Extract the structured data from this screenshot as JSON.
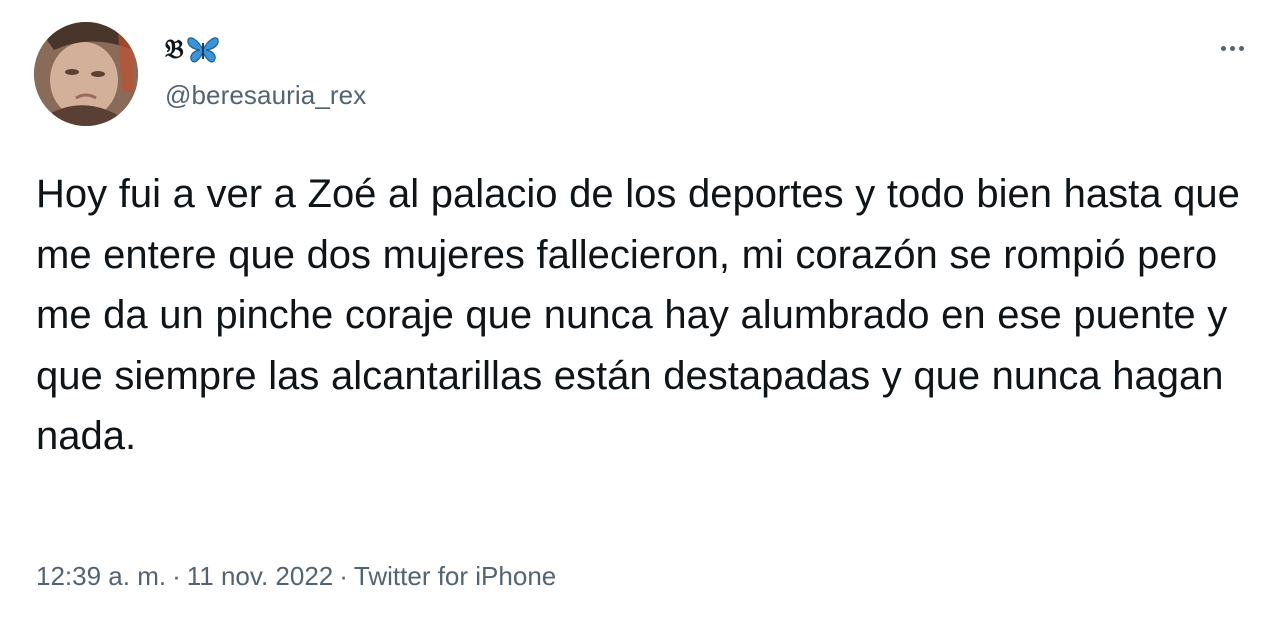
{
  "user": {
    "display_name_letter": "𝔅",
    "display_name_emoji": "🦋",
    "handle": "@beresauria_rex",
    "avatar_icon": "profile-photo"
  },
  "tweet": {
    "text": "Hoy fui a ver a Zoé al palacio de los deportes y todo bien hasta que me entere que dos mujeres fallecieron, mi corazón se rompió pero me da un pinche coraje que nunca hay alumbrado en ese puente y que siempre las alcantarillas están destapadas y que nunca hagan nada."
  },
  "meta": {
    "time": "12:39 a. m.",
    "separator": "·",
    "date": "11 nov. 2022",
    "source": "Twitter for iPhone"
  },
  "more_icon": "more-horizontal-icon",
  "colors": {
    "text_primary": "#0f1419",
    "text_secondary": "#536471",
    "butterfly": "#3b94d9"
  }
}
